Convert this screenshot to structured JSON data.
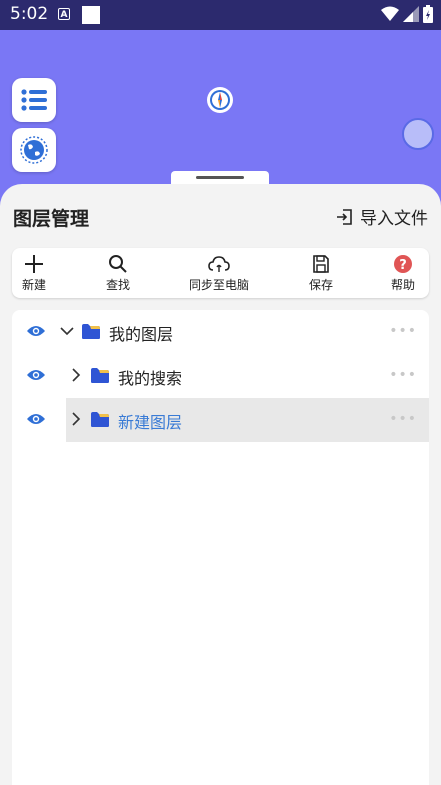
{
  "status": {
    "time": "5:02"
  },
  "panel": {
    "title": "图层管理",
    "import_label": "导入文件"
  },
  "toolbar": [
    {
      "label": "新建",
      "icon": "plus-icon"
    },
    {
      "label": "查找",
      "icon": "search-icon"
    },
    {
      "label": "同步至电脑",
      "icon": "cloud-sync-icon"
    },
    {
      "label": "保存",
      "icon": "save-icon"
    },
    {
      "label": "帮助",
      "icon": "help-icon"
    }
  ],
  "layers": [
    {
      "name": "我的图层",
      "expanded": true,
      "selected": false
    },
    {
      "name": "我的搜索",
      "expanded": false,
      "selected": false
    },
    {
      "name": "新建图层",
      "expanded": false,
      "selected": true
    }
  ],
  "colors": {
    "accent": "#3a7bd5",
    "map_bg": "#7a77f5",
    "status_bar": "#2c2a6e",
    "help_red": "#e05555"
  }
}
